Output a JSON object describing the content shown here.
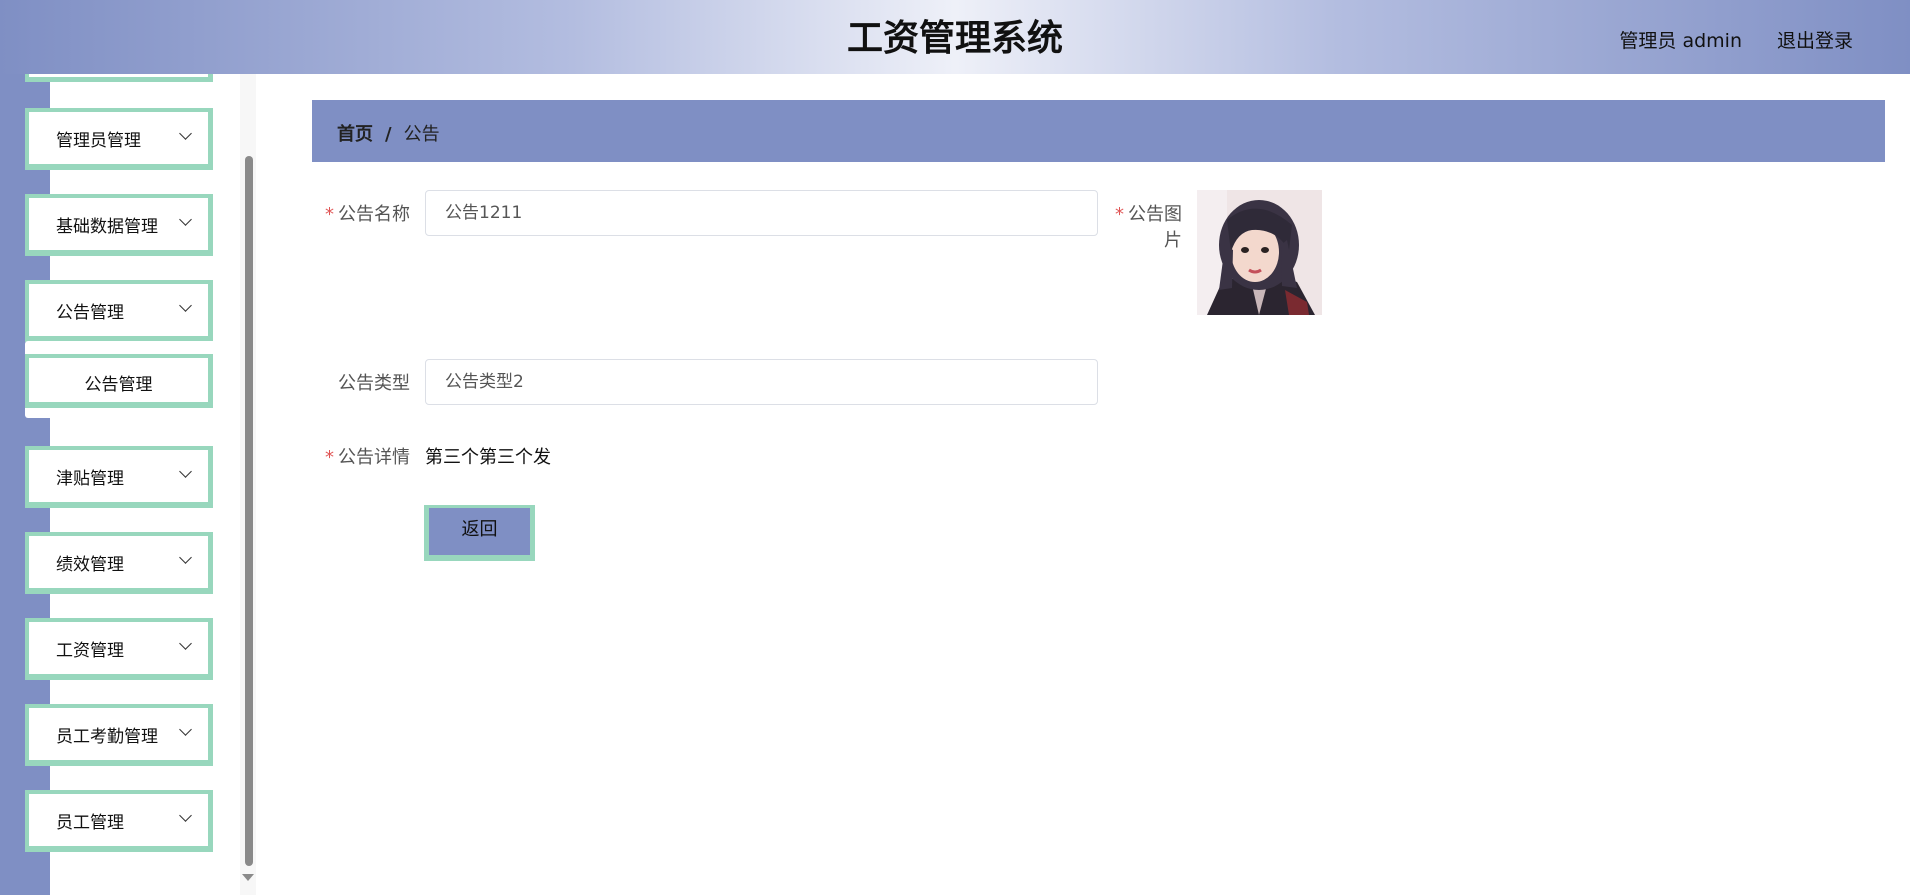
{
  "header": {
    "title": "工资管理系统",
    "user": "管理员 admin",
    "logout": "退出登录"
  },
  "sidebar": {
    "items": [
      {
        "label": "管理员管理"
      },
      {
        "label": "基础数据管理"
      },
      {
        "label": "公告管理"
      },
      {
        "label": "津贴管理"
      },
      {
        "label": "绩效管理"
      },
      {
        "label": "工资管理"
      },
      {
        "label": "员工考勤管理"
      },
      {
        "label": "员工管理"
      }
    ],
    "submenu": {
      "label": "公告管理"
    }
  },
  "breadcrumb": {
    "home": "首页",
    "separator": "/",
    "current": "公告"
  },
  "form": {
    "name": {
      "label": "公告名称",
      "value": "公告1211",
      "required": true
    },
    "image": {
      "label": "公告图片",
      "required": true
    },
    "type": {
      "label": "公告类型",
      "value": "公告类型2",
      "required": false
    },
    "detail": {
      "label": "公告详情",
      "value": "第三个第三个发",
      "required": true
    },
    "required_mark": "*",
    "back_button": "返回"
  },
  "colors": {
    "accent": "#7f8fc4",
    "border_accent": "#98d7bd",
    "required": "#e05555"
  }
}
